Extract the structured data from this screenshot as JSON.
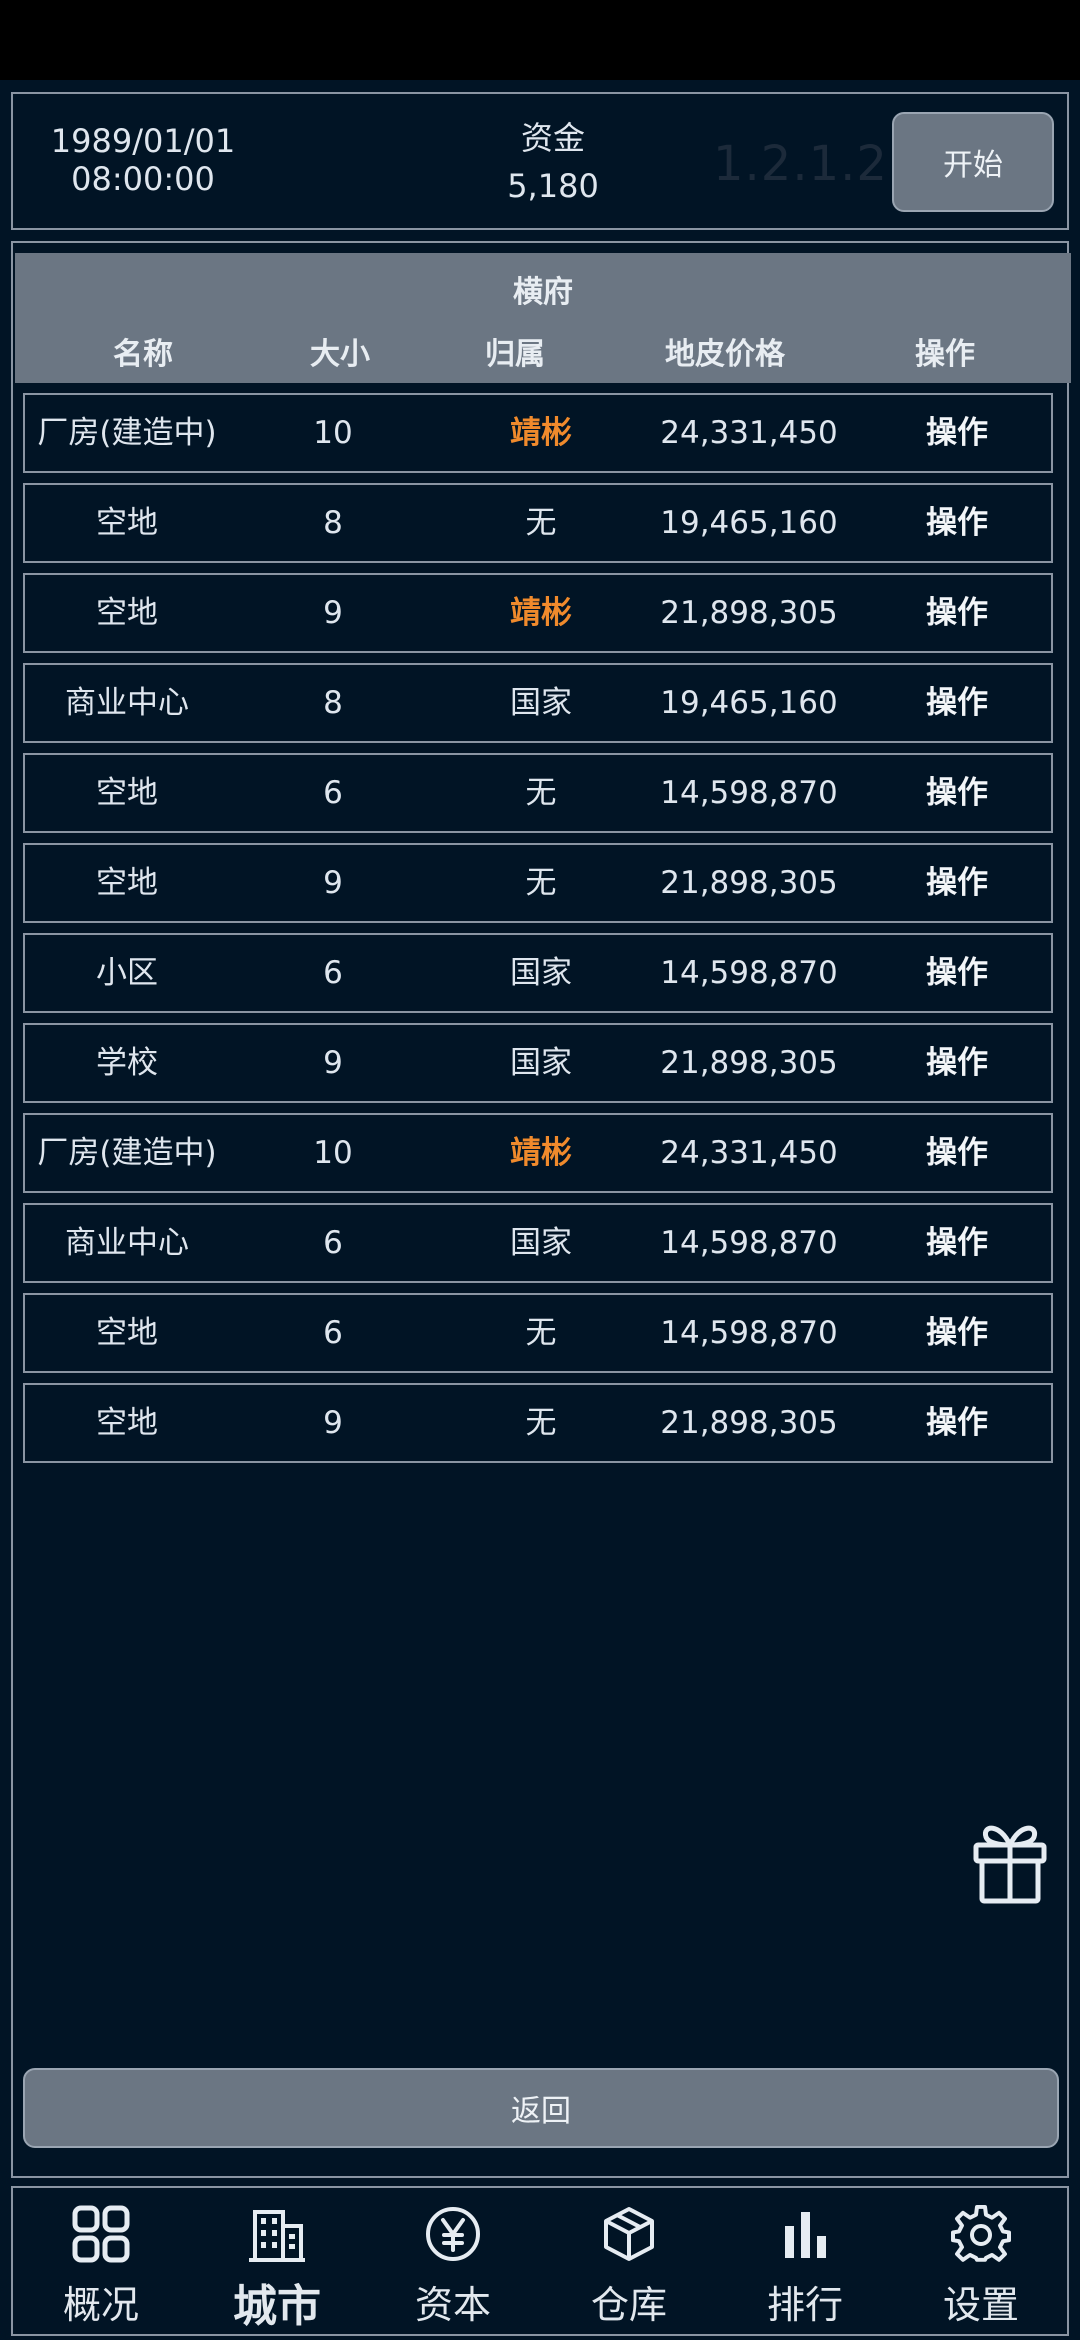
{
  "header": {
    "date": "1989/01/01",
    "time": "08:00:00",
    "funds_label": "资金",
    "funds_value": "5,180",
    "version": "1.2.1.2",
    "start_label": "开始"
  },
  "city": {
    "name": "横府",
    "columns": [
      "名称",
      "大小",
      "归属",
      "地皮价格",
      "操作"
    ]
  },
  "rows": [
    {
      "name": "厂房(建造中)",
      "size": "10",
      "owner": "靖彬",
      "price": "24,331,450",
      "action": "操作"
    },
    {
      "name": "空地",
      "size": "8",
      "owner": "无",
      "price": "19,465,160",
      "action": "操作"
    },
    {
      "name": "空地",
      "size": "9",
      "owner": "靖彬",
      "price": "21,898,305",
      "action": "操作"
    },
    {
      "name": "商业中心",
      "size": "8",
      "owner": "国家",
      "price": "19,465,160",
      "action": "操作"
    },
    {
      "name": "空地",
      "size": "6",
      "owner": "无",
      "price": "14,598,870",
      "action": "操作"
    },
    {
      "name": "空地",
      "size": "9",
      "owner": "无",
      "price": "21,898,305",
      "action": "操作"
    },
    {
      "name": "小区",
      "size": "6",
      "owner": "国家",
      "price": "14,598,870",
      "action": "操作"
    },
    {
      "name": "学校",
      "size": "9",
      "owner": "国家",
      "price": "21,898,305",
      "action": "操作"
    },
    {
      "name": "厂房(建造中)",
      "size": "10",
      "owner": "靖彬",
      "price": "24,331,450",
      "action": "操作"
    },
    {
      "name": "商业中心",
      "size": "6",
      "owner": "国家",
      "price": "14,598,870",
      "action": "操作"
    },
    {
      "name": "空地",
      "size": "6",
      "owner": "无",
      "price": "14,598,870",
      "action": "操作"
    },
    {
      "name": "空地",
      "size": "9",
      "owner": "无",
      "price": "21,898,305",
      "action": "操作"
    }
  ],
  "back_label": "返回",
  "highlight_owner": "靖彬",
  "colors": {
    "accent_owner": "#f08a2c",
    "panel": "#6b7683",
    "background": "#011425"
  },
  "tabs": [
    {
      "label": "概况",
      "icon": "grid-icon",
      "active": false
    },
    {
      "label": "城市",
      "icon": "building-icon",
      "active": true
    },
    {
      "label": "资本",
      "icon": "yen-icon",
      "active": false
    },
    {
      "label": "仓库",
      "icon": "box-icon",
      "active": false
    },
    {
      "label": "排行",
      "icon": "bar-chart-icon",
      "active": false
    },
    {
      "label": "设置",
      "icon": "gear-icon",
      "active": false
    }
  ]
}
